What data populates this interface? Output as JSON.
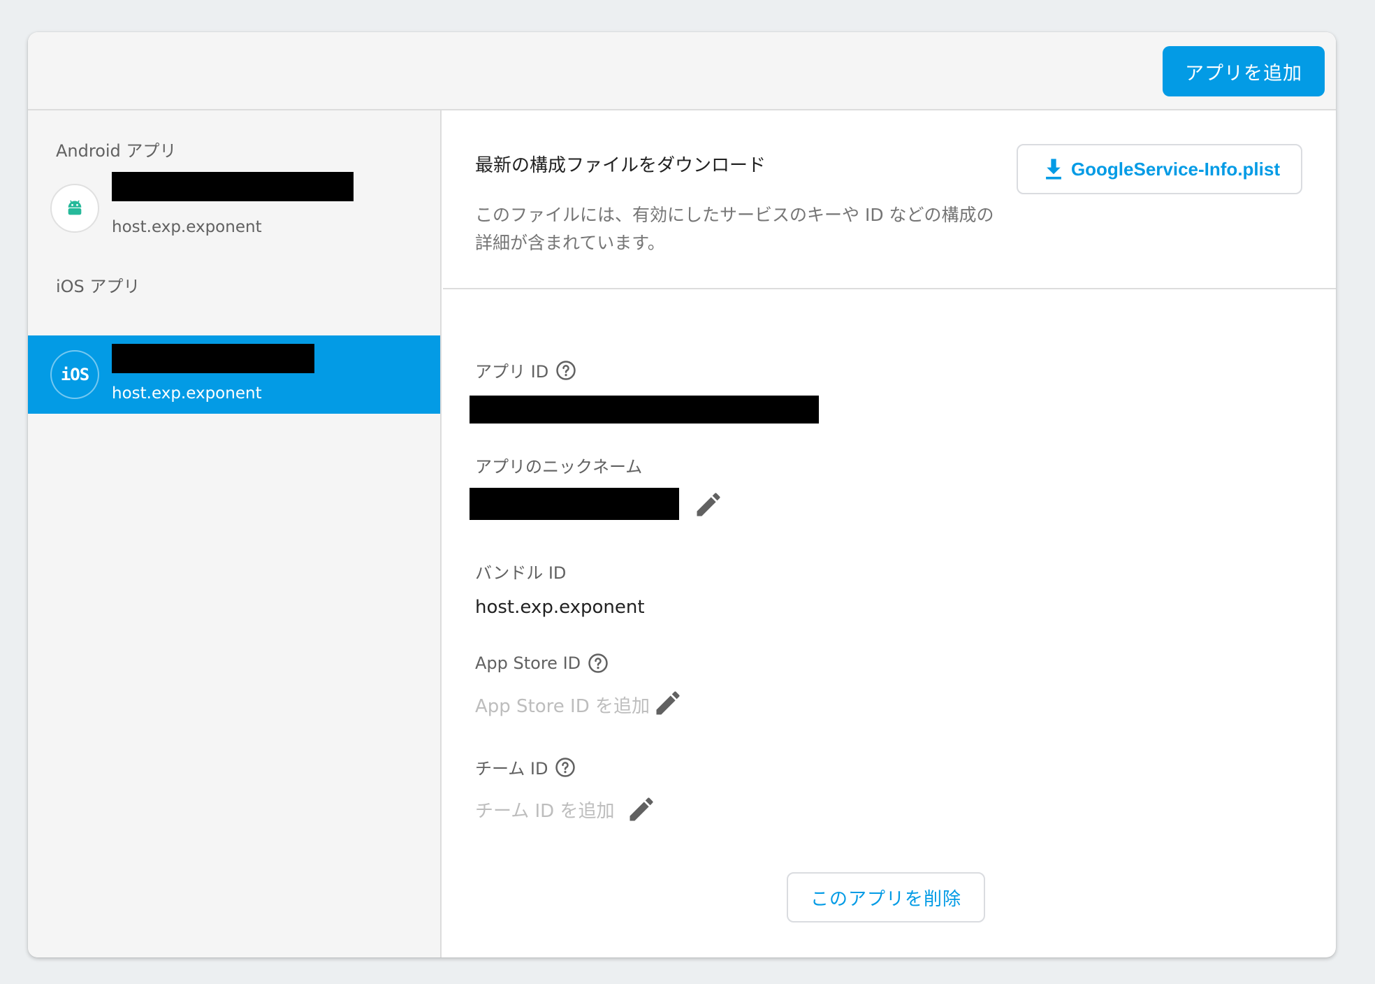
{
  "toolbar": {
    "add_app_label": "アプリを追加"
  },
  "sidebar": {
    "android_section_label": "Android アプリ",
    "android_app": {
      "package": "host.exp.exponent",
      "icon": "android-icon"
    },
    "ios_section_label": "iOS アプリ",
    "ios_app": {
      "package": "host.exp.exponent",
      "icon_text": "iOS"
    }
  },
  "download": {
    "title": "最新の構成ファイルをダウンロード",
    "description": "このファイルには、有効にしたサービスのキーや ID などの構成の詳細が含まれています。",
    "button_label": "GoogleService-Info.plist"
  },
  "fields": {
    "app_id_label": "アプリ ID",
    "nickname_label": "アプリのニックネーム",
    "bundle_id_label": "バンドル ID",
    "bundle_id_value": "host.exp.exponent",
    "app_store_id_label": "App Store ID",
    "app_store_id_placeholder": "App Store ID を追加",
    "team_id_label": "チーム ID",
    "team_id_placeholder": "チーム ID を追加"
  },
  "actions": {
    "delete_label": "このアプリを削除"
  },
  "colors": {
    "accent": "#039be5",
    "android_green": "#26b99a"
  }
}
